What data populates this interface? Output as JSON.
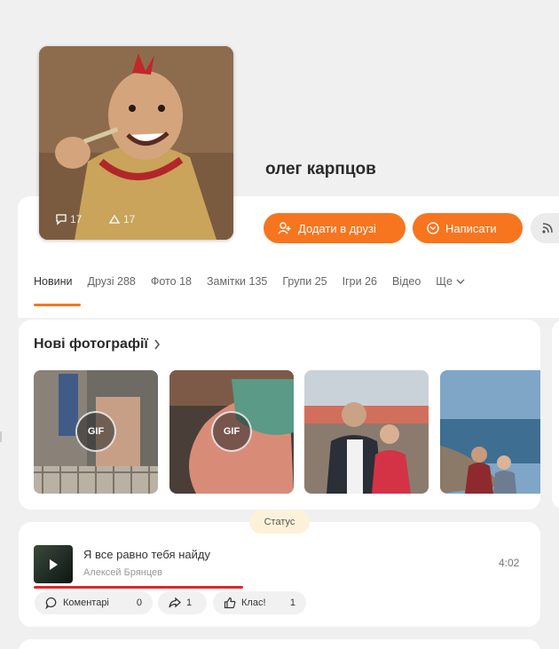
{
  "profile": {
    "name": "олег карпцов",
    "avatar_stats": {
      "comments": "17",
      "shares": "17"
    }
  },
  "actions": {
    "add_friend": "Додати в друзі",
    "write": "Написати"
  },
  "tabs": [
    {
      "label": "Новини",
      "active": true
    },
    {
      "label": "Друзі 288"
    },
    {
      "label": "Фото 18"
    },
    {
      "label": "Замітки 135"
    },
    {
      "label": "Групи 25"
    },
    {
      "label": "Ігри 26"
    },
    {
      "label": "Відео"
    },
    {
      "label": "Ще"
    }
  ],
  "photos": {
    "title": "Нові фотографії",
    "items": [
      {
        "kind": "gif",
        "badge": "GIF"
      },
      {
        "kind": "gif",
        "badge": "GIF"
      },
      {
        "kind": "photo"
      },
      {
        "kind": "photo"
      }
    ]
  },
  "status": {
    "label": "Статус",
    "track_title": "Я все равно тебя найду",
    "track_artist": "Алексей Брянцев",
    "duration": "4:02",
    "progress": 0.5,
    "comment_label": "Коментарі",
    "comment_count": "0",
    "share_count": "1",
    "like_label": "Клас!",
    "like_count": "1"
  },
  "colors": {
    "accent": "#f7751f",
    "progress": "#e2262a",
    "status_bg": "#fdf2d9"
  }
}
